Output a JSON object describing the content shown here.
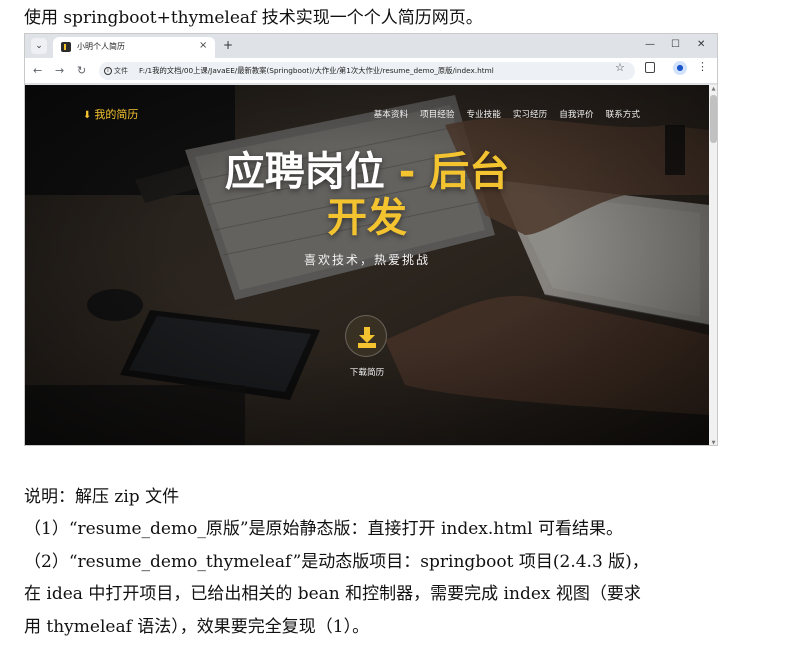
{
  "doc": {
    "heading": "使用 springboot+thymeleaf 技术实现一个个人简历网页。",
    "lines": [
      "说明：解压 zip 文件",
      "（1）“resume_demo_原版”是原始静态版：直接打开 index.html 可看结果。",
      "（2）“resume_demo_thymeleaf”是动态版项目：springboot 项目(2.4.3 版)，",
      "在 idea 中打开项目，已给出相关的 bean 和控制器，需要完成 index 视图（要求",
      "用 thymeleaf 语法），效果要完全复现（1）。"
    ]
  },
  "browser": {
    "tab_title": "小明个人简历",
    "tab_close": "×",
    "new_tab": "+",
    "tab_list_glyph": "⌄",
    "win_min": "—",
    "win_max": "☐",
    "win_close": "✕",
    "back": "←",
    "forward": "→",
    "reload": "↻",
    "info_label": "文件",
    "info_glyph": "i",
    "url": "F:/1我的文档/00上课/JavaEE/最新教案(Springboot)/大作业/第1次大作业/resume_demo_原版/index.html",
    "star": "☆",
    "profile_glyph": "●",
    "menu": "⋮"
  },
  "site": {
    "logo_glyph": "⬇",
    "logo_text": "我的简历",
    "nav": [
      "基本资料",
      "项目经验",
      "专业技能",
      "实习经历",
      "自我评价",
      "联系方式"
    ],
    "hero_title_white": "应聘岗位",
    "hero_title_dash": " - ",
    "hero_title_gold_1": "后台",
    "hero_title_gold_2": "开发",
    "hero_subtitle": "喜欢技术，热爱挑战",
    "download_label": "下载简历"
  },
  "scrollbar": {
    "up": "▲",
    "down": "▼",
    "position": 0
  }
}
